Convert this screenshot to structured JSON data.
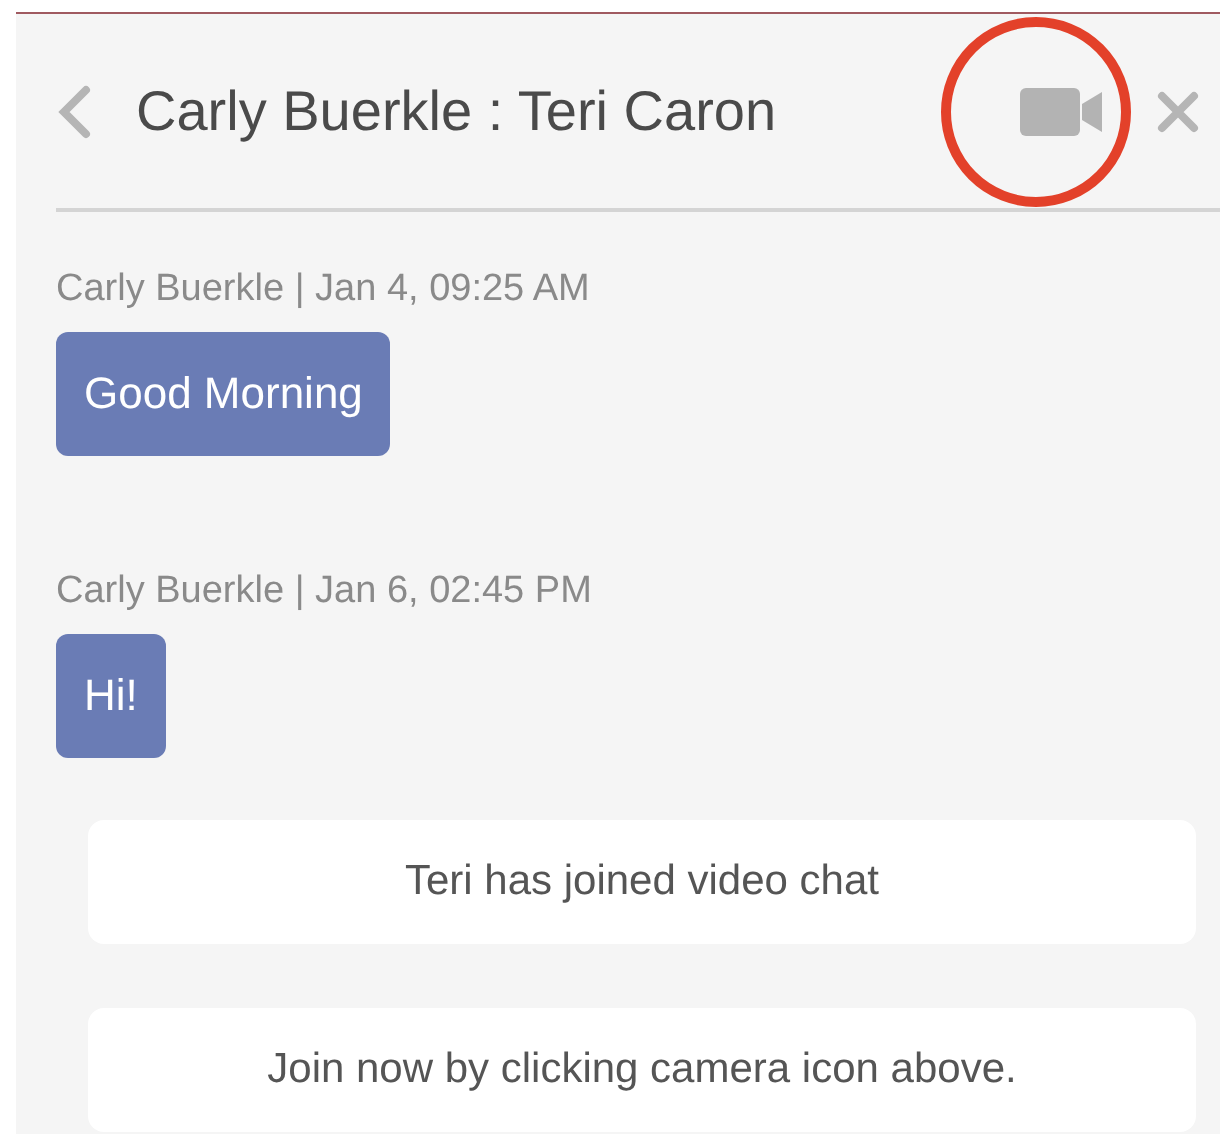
{
  "header": {
    "title": "Carly Buerkle : Teri Caron"
  },
  "messages": [
    {
      "kind": "message",
      "meta": "Carly Buerkle | Jan 4, 09:25 AM",
      "text": "Good Morning"
    },
    {
      "kind": "message",
      "meta": "Carly Buerkle | Jan 6, 02:45 PM",
      "text": "Hi!"
    },
    {
      "kind": "notice",
      "text": "Teri has joined video chat"
    },
    {
      "kind": "notice",
      "text": "Join now by clicking camera icon above."
    }
  ]
}
